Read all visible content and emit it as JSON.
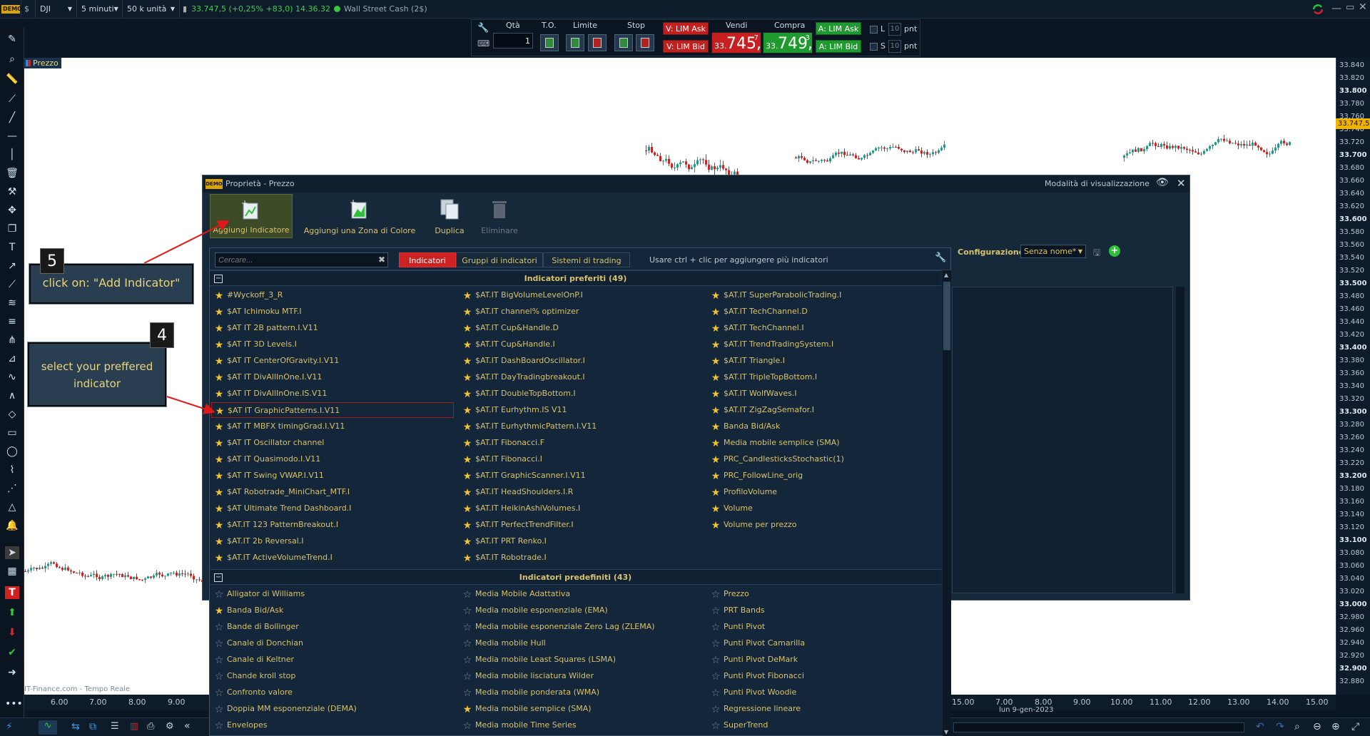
{
  "topbar": {
    "demo": "DEMO",
    "symbol": "DJI",
    "timeframe": "5 minuti",
    "units": "50 k unità",
    "quote": "33.747,5 (+0,25% +83,0) 14.36.32",
    "instrument": "Wall Street Cash (2$)"
  },
  "tradebar": {
    "qty_label": "Qtà",
    "qty_value": "1",
    "to_label": "T.O.",
    "limit_label": "Limite",
    "stop_label": "Stop",
    "sell_label": "Vendi",
    "buy_label": "Compra",
    "v_lim_ask": "V: LIM Ask",
    "v_lim_bid": "V: LIM Bid",
    "a_lim_ask": "A: LIM Ask",
    "a_lim_bid": "A: LIM Bid",
    "sell_small": "33.",
    "sell_big": "745,",
    "sell_sup": "7",
    "buy_small": "33.",
    "buy_big": "749,",
    "buy_sup": "3",
    "l_label": "L",
    "s_label": "S",
    "l_value": "10",
    "s_value": "10",
    "pnt": "pnt"
  },
  "chart": {
    "legend_label": "Prezzo",
    "watermark": "IT-Finance.com - Tempo Reale",
    "current_price": "33.747,5",
    "y_ticks": [
      "33.840",
      "33.820",
      "33.800",
      "33.780",
      "33.760",
      "33.740",
      "33.720",
      "33.700",
      "33.680",
      "33.660",
      "33.640",
      "33.620",
      "33.600",
      "33.580",
      "33.560",
      "33.540",
      "33.520",
      "33.500",
      "33.480",
      "33.460",
      "33.440",
      "33.420",
      "33.400",
      "33.380",
      "33.360",
      "33.340",
      "33.320",
      "33.300",
      "33.280",
      "33.260",
      "33.240",
      "33.220",
      "33.200",
      "33.180",
      "33.160",
      "33.140",
      "33.120",
      "33.100",
      "33.080",
      "33.060",
      "33.040",
      "33.020",
      "33.000",
      "32.980",
      "32.960",
      "32.940",
      "32.920",
      "32.900",
      "32.880"
    ],
    "x_ticks_left": [
      "6.00",
      "7.00",
      "8.00",
      "9.00"
    ],
    "x_ticks_right": [
      "15.00",
      "7.00",
      "8.00",
      "9.00",
      "10.00",
      "11.00",
      "12.00",
      "13.00",
      "14.00",
      "15.00"
    ],
    "date_label": "lun 9-gen-2023"
  },
  "dialog": {
    "title": "Proprietà - Prezzo",
    "view_mode": "Modalità di visualizzazione",
    "add_indicator": "Aggiungi Indicatore",
    "add_color_zone": "Aggiungi una Zona di Colore",
    "duplicate": "Duplica",
    "delete": "Eliminare",
    "config_label": "Configurazione:",
    "config_value": "Senza nome*"
  },
  "panel": {
    "search_placeholder": "Cercare...",
    "tab_indicators": "Indicatori",
    "tab_groups": "Gruppi di indicatori",
    "tab_systems": "Sistemi di trading",
    "hint": "Usare ctrl + clic per aggiungere più indicatori",
    "favorites_title": "Indicatori preferiti (49)",
    "predefined_title": "Indicatori predefiniti (43)",
    "fav_col1": [
      "#Wyckoff_3_R",
      "$AT Ichimoku MTF.I",
      "$AT IT 2B pattern.I.V11",
      "$AT IT 3D Levels.I",
      "$AT IT CenterOfGravity.I.V11",
      "$AT IT DivAllInOne.I.V11",
      "$AT IT DivAllInOne.IS.V11",
      "$AT IT GraphicPatterns.I.V11",
      "$AT IT MBFX timingGrad.I.V11",
      "$AT IT Oscillator channel",
      "$AT IT Quasimodo.I.V11",
      "$AT IT Swing VWAP.I.V11",
      "$AT Robotrade_MiniChart_MTF.I",
      "$AT Ultimate Trend Dashboard.I",
      "$AT.IT 123 PatternBreakout.I",
      "$AT.IT 2b Reversal.I",
      "$AT.IT ActiveVolumeTrend.I"
    ],
    "fav_col2": [
      "$AT.IT BigVolumeLevelOnP.I",
      "$AT.IT channel% optimizer",
      "$AT.IT Cup&Handle.D",
      "$AT.IT Cup&Handle.I",
      "$AT.IT DashBoardOscillator.I",
      "$AT.IT DayTradingbreakout.I",
      "$AT.IT DoubleTopBottom.I",
      "$AT.IT Eurhythm.IS V11",
      "$AT.IT EurhythmicPattern.I.V11",
      "$AT.IT Fibonacci.F",
      "$AT.IT Fibonacci.I",
      "$AT.IT GraphicScanner.I.V11",
      "$AT.IT HeadShoulders.I.R",
      "$AT.IT HeikinAshiVolumes.I",
      "$AT.IT PerfectTrendFilter.I",
      "$AT.IT PRT Renko.I",
      "$AT.IT Robotrade.I"
    ],
    "fav_col3": [
      "$AT.IT SuperParabolicTrading.I",
      "$AT.IT TechChannel.D",
      "$AT.IT TechChannel.I",
      "$AT.IT TrendTradingSystem.I",
      "$AT.IT Triangle.I",
      "$AT.IT TripleTopBottom.I",
      "$AT.IT WolfWaves.I",
      "$AT.IT ZigZagSemafor.I",
      "Banda Bid/Ask",
      "Media mobile semplice (SMA)",
      "PRC_CandlesticksStochastic(1)",
      "PRC_FollowLine_orig",
      "ProfiloVolume",
      "Volume",
      "Volume per prezzo"
    ],
    "pre_col1": [
      "Alligator di Williams",
      "Banda Bid/Ask",
      "Bande di Bollinger",
      "Canale di Donchian",
      "Canale di Keltner",
      "Chande kroll stop",
      "Confronto valore",
      "Doppia MM esponenziale (DEMA)",
      "Envelopes"
    ],
    "pre_col2": [
      "Media Mobile Adattativa",
      "Media mobile esponenziale (EMA)",
      "Media mobile esponenziale Zero Lag (ZLEMA)",
      "Media mobile Hull",
      "Media mobile Least Squares (LSMA)",
      "Media mobile lisciatura Wilder",
      "Media mobile ponderata (WMA)",
      "Media mobile semplice (SMA)",
      "Media mobile Time Series"
    ],
    "pre_col3": [
      "Prezzo",
      "PRT Bands",
      "Punti Pivot",
      "Punti Pivot Camarilla",
      "Punti Pivot DeMark",
      "Punti Pivot Fibonacci",
      "Punti Pivot Woodie",
      "Regressione lineare",
      "SuperTrend"
    ],
    "pre_col2_fav": [
      false,
      false,
      false,
      false,
      false,
      false,
      false,
      true,
      false
    ],
    "pre_col1_fav": [
      false,
      true,
      false,
      false,
      false,
      false,
      false,
      false,
      false
    ]
  },
  "callouts": {
    "step5_num": "5",
    "step5_text": "click on: \"Add Indicator\"",
    "step4_num": "4",
    "step4_text": "select your preffered indicator"
  },
  "colors": {
    "accent_red": "#cc2222",
    "accent_green": "#1f9a2e",
    "gold_text": "#d9c16a",
    "price_tag": "#f0b400"
  }
}
